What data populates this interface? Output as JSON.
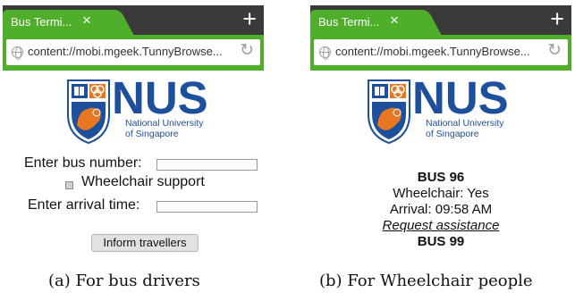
{
  "panels": [
    {
      "tab_title": "Bus Termi...",
      "url": "content://mobi.mgeek.TunnyBrowse...",
      "logo": {
        "name": "NUS",
        "line1": "National University",
        "line2": "of Singapore"
      },
      "form": {
        "bus_number_label": "Enter bus number:",
        "wheelchair_label": "Wheelchair support",
        "arrival_label": "Enter arrival time:",
        "button_label": "Inform travellers"
      },
      "caption": "(a) For bus drivers"
    },
    {
      "tab_title": "Bus Termi...",
      "url": "content://mobi.mgeek.TunnyBrowse...",
      "logo": {
        "name": "NUS",
        "line1": "National University",
        "line2": "of Singapore"
      },
      "buses": [
        {
          "title": "BUS 96",
          "wheelchair": "Wheelchair: Yes",
          "arrival": "Arrival: 09:58 AM",
          "link": "Request assistance"
        },
        {
          "title": "BUS 99"
        }
      ],
      "caption": "(b) For Wheelchair people"
    }
  ],
  "colors": {
    "toolbar_green": "#4faf2b",
    "tabstrip_dark": "#3a3a3a",
    "nus_blue": "#1d4f9c",
    "nus_orange": "#e87722"
  },
  "icons": {
    "tab_close": "×",
    "new_tab": "+",
    "reload": "↻",
    "site": "globe-icon"
  }
}
